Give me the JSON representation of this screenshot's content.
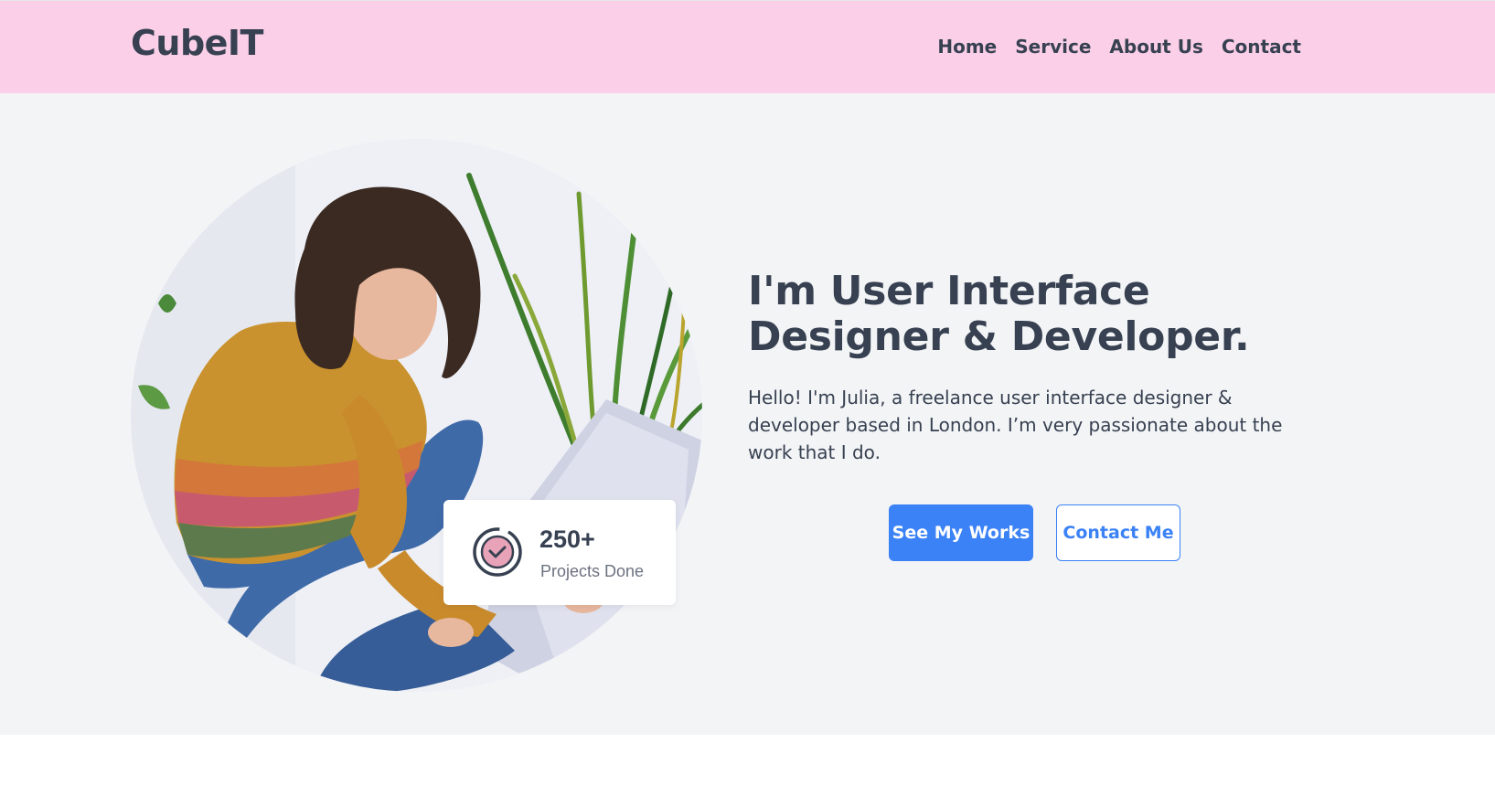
{
  "brand": {
    "name": "CubeIT"
  },
  "nav": {
    "items": [
      "Home",
      "Service",
      "About Us",
      "Contact"
    ]
  },
  "hero": {
    "headline": "I'm User Interface Designer & Developer.",
    "intro": "Hello! I'm Julia, a freelance user interface designer & developer based in London. I’m very passionate about the work that I do.",
    "buttons": {
      "primary": "See My Works",
      "secondary": "Contact Me"
    },
    "stat": {
      "value": "250+",
      "label": "Projects Done",
      "icon": "check-badge-icon"
    }
  },
  "colors": {
    "navbar_bg": "#fbcfe8",
    "hero_bg": "#f3f4f6",
    "text": "#374151",
    "accent": "#3b82f6",
    "badge_pink": "#e9a3b8"
  }
}
